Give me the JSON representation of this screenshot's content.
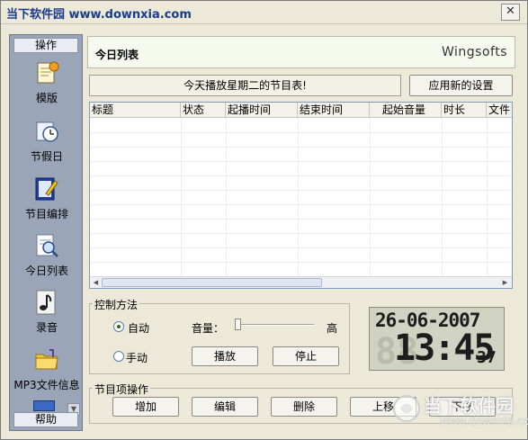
{
  "window": {
    "title": "当下软件园 www.downxia.com",
    "close_glyph": "✕"
  },
  "sidebar": {
    "header": "操作",
    "footer": "帮助",
    "items": [
      {
        "label": "模版",
        "icon": "template-icon"
      },
      {
        "label": "节假日",
        "icon": "holiday-clock-icon"
      },
      {
        "label": "节目编排",
        "icon": "schedule-edit-icon"
      },
      {
        "label": "今日列表",
        "icon": "today-list-icon"
      },
      {
        "label": "录音",
        "icon": "music-note-icon"
      },
      {
        "label": "MP3文件信息",
        "icon": "folder-icon"
      }
    ],
    "scroll_glyph": "▼"
  },
  "panel": {
    "title": "今日列表",
    "brand": "Wingsofts"
  },
  "message": "今天播放星期二的节目表!",
  "apply_button": "应用新的设置",
  "table": {
    "columns": [
      "标题",
      "状态",
      "起播时间",
      "结束时间",
      "起始音量",
      "时长",
      "文件"
    ],
    "rows": []
  },
  "control": {
    "legend": "控制方法",
    "auto_label": "自动",
    "manual_label": "手动",
    "selected": "自动",
    "volume_label": "音量：",
    "volume_high": "高",
    "volume_level": 0.0,
    "play_button": "播放",
    "stop_button": "停止"
  },
  "clock": {
    "date": "26-06-2007",
    "time": "13:45",
    "seconds": "37",
    "ghost": "88"
  },
  "program_ops": {
    "legend": "节目项操作",
    "add": "增加",
    "edit": "编辑",
    "delete": "删除",
    "move_up": "上移",
    "move_down": "下移"
  },
  "watermark": {
    "text": "当下软件园",
    "url": "www.downxia.com"
  }
}
